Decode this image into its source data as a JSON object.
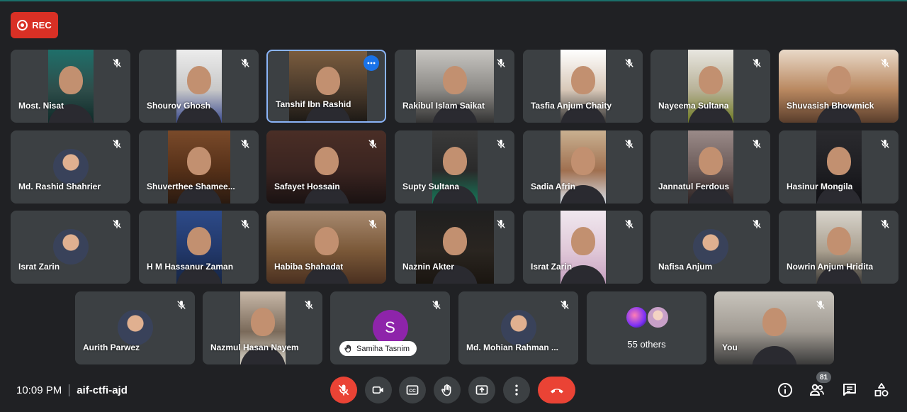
{
  "recording": {
    "label": "REC"
  },
  "participants": [
    {
      "name": "Most. Nisat",
      "type": "video"
    },
    {
      "name": "Shourov Ghosh",
      "type": "video"
    },
    {
      "name": "Tanshif Ibn Rashid",
      "type": "video",
      "active": true
    },
    {
      "name": "Rakibul Islam Saikat",
      "type": "video"
    },
    {
      "name": "Tasfia Anjum Chaity",
      "type": "video"
    },
    {
      "name": "Nayeema Sultana",
      "type": "video"
    },
    {
      "name": "Shuvasish Bhowmick",
      "type": "video"
    },
    {
      "name": "Md. Rashid Shahrier",
      "type": "avatar"
    },
    {
      "name": "Shuverthee Shamee...",
      "type": "video"
    },
    {
      "name": "Safayet Hossain",
      "type": "video"
    },
    {
      "name": "Supty Sultana",
      "type": "video"
    },
    {
      "name": "Sadia Afrin",
      "type": "video"
    },
    {
      "name": "Jannatul Ferdous",
      "type": "video"
    },
    {
      "name": "Hasinur Mongila",
      "type": "video"
    },
    {
      "name": "Israt Zarin",
      "type": "avatar"
    },
    {
      "name": "H M Hassanur Zaman",
      "type": "video"
    },
    {
      "name": "Habiba Shahadat",
      "type": "video"
    },
    {
      "name": "Naznin Akter",
      "type": "video"
    },
    {
      "name": "Israt Zarin",
      "type": "video"
    },
    {
      "name": "Nafisa Anjum",
      "type": "avatar"
    },
    {
      "name": "Nowrin Anjum Hridita",
      "type": "video"
    },
    {
      "name": "Aurith Parwez",
      "type": "avatar"
    },
    {
      "name": "Nazmul Hasan Nayem",
      "type": "video"
    },
    {
      "name": "Samiha Tasnim",
      "type": "initial",
      "initial": "S",
      "hand_raised": true
    },
    {
      "name": "Md. Mohian Rahman ...",
      "type": "avatar"
    },
    {
      "name": "You",
      "type": "video"
    }
  ],
  "others": {
    "label": "55 others"
  },
  "footer": {
    "time": "10:09 PM",
    "meeting_code": "aif-ctfi-ajd",
    "people_count": "81"
  },
  "colors": {
    "background": "#202124",
    "tile": "#3c4043",
    "danger": "#ea4335",
    "active_border": "#8ab4f8",
    "accent": "#1a73e8"
  },
  "icons": {
    "mic_off": "mic-off-icon",
    "camera": "camera-icon",
    "captions": "captions-icon",
    "hand": "raise-hand-icon",
    "present": "present-screen-icon",
    "more": "more-options-icon",
    "end_call": "phone-hangup-icon",
    "info": "info-icon",
    "people": "people-icon",
    "chat": "chat-icon",
    "activities": "activities-icon"
  }
}
